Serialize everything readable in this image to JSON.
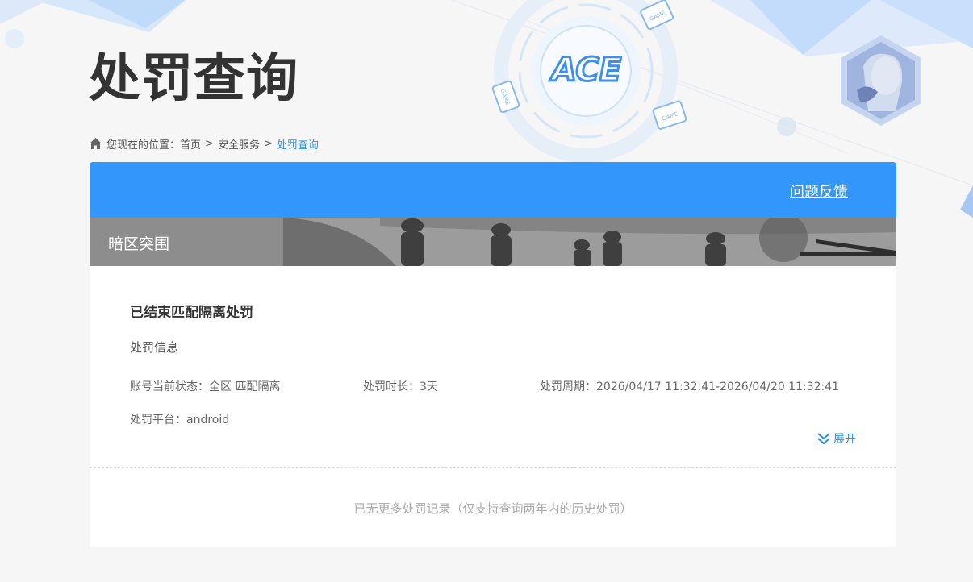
{
  "page": {
    "title": "处罚查询"
  },
  "logo": {
    "text": "ACE",
    "badge": "GAME"
  },
  "breadcrumb": {
    "prefix": "您现在的位置：",
    "items": [
      "首页",
      "安全服务",
      "处罚查询"
    ],
    "separator": ">"
  },
  "panel": {
    "feedback_label": "问题反馈",
    "game_name": "暗区突围"
  },
  "record": {
    "title": "已结束匹配隔离处罚",
    "section_label": "处罚信息",
    "account_status": "账号当前状态：全区 匹配隔离",
    "duration": "处罚时长：3天",
    "period": "处罚周期：2026/04/17 11:32:41-2026/04/20 11:32:41",
    "platform": "处罚平台：android",
    "expand_label": "展开"
  },
  "footer": {
    "note": "已无更多处罚记录（仅支持查询两年内的历史处罚）"
  },
  "colors": {
    "accent": "#3296fa",
    "link": "#2f8fe0",
    "title": "#333333",
    "muted": "#aaaaaa"
  }
}
